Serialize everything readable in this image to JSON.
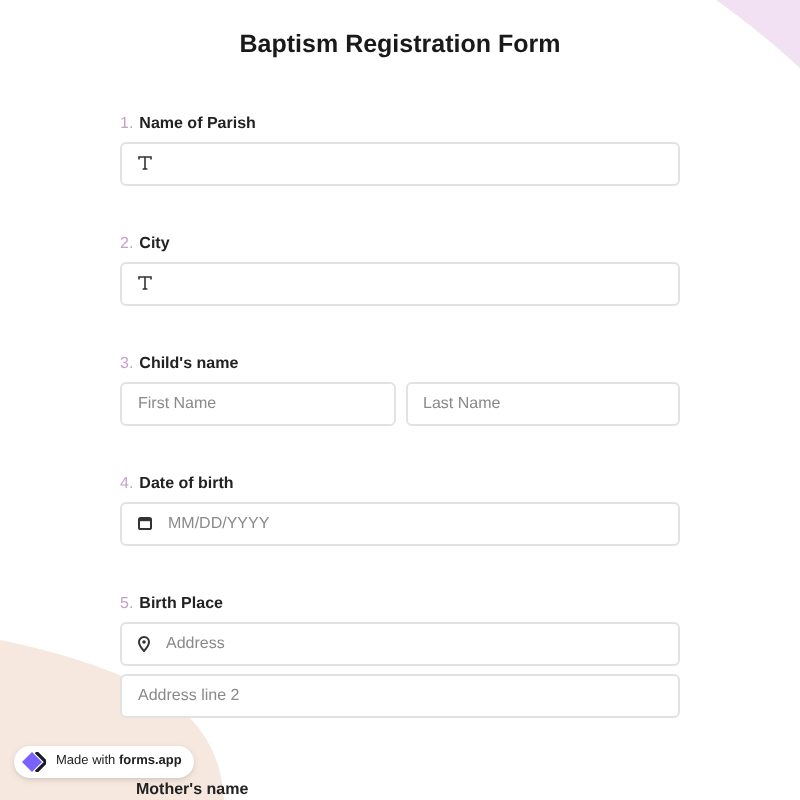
{
  "title": "Baptism Registration Form",
  "questions": [
    {
      "number": "1.",
      "label": "Name of Parish",
      "kind": "text"
    },
    {
      "number": "2.",
      "label": "City",
      "kind": "text"
    },
    {
      "number": "3.",
      "label": "Child's name",
      "kind": "name",
      "inputs": [
        {
          "placeholder": "First Name"
        },
        {
          "placeholder": "Last Name"
        }
      ]
    },
    {
      "number": "4.",
      "label": "Date of birth",
      "kind": "date",
      "inputs": [
        {
          "placeholder": "MM/DD/YYYY"
        }
      ]
    },
    {
      "number": "5.",
      "label": "Birth Place",
      "kind": "address",
      "inputs": [
        {
          "placeholder": "Address"
        },
        {
          "placeholder": "Address line 2"
        }
      ]
    },
    {
      "label": "Mother's name",
      "kind": "partial"
    }
  ],
  "badge": {
    "text": "Made with **forms.app**"
  }
}
